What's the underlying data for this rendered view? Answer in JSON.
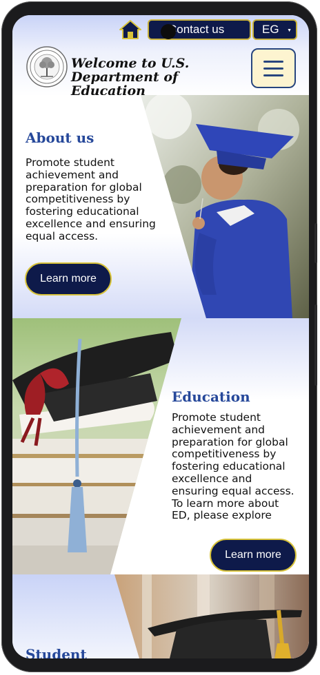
{
  "header": {
    "contact_label": "Contact us",
    "language": "EG",
    "title_line1": "Welcome to U.S.",
    "title_line2": "Department of Education"
  },
  "sections": [
    {
      "title": "About us",
      "text": "Promote student achievement and preparation for global competitiveness by fostering educational excellence and ensuring equal access.",
      "button": "Learn more"
    },
    {
      "title": "Education",
      "text": "Promote student achievement and preparation for global competitiveness by fostering educational excellence and ensuring equal access.",
      "text2": "To learn more about ED, please explore",
      "button": "Learn more"
    },
    {
      "title": "Student"
    }
  ],
  "colors": {
    "navy": "#0e1a4a",
    "gold_border": "#d8c33a",
    "title_blue": "#26489a",
    "header_gradient": "#c9d3f7",
    "menu_bg": "#fdf4d0"
  },
  "icons": {
    "home": "home-icon",
    "menu": "hamburger-menu-icon",
    "dropdown": "caret-down-icon",
    "logo": "department-seal"
  }
}
